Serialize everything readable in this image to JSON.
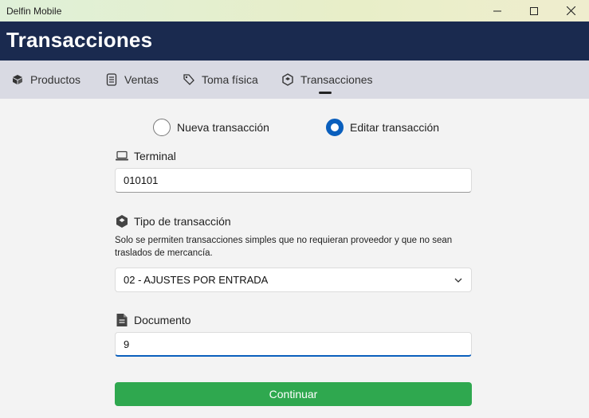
{
  "window": {
    "title": "Delfin Mobile",
    "controls": {
      "minimize": "minimize-icon",
      "maximize": "maximize-icon",
      "close": "close-icon"
    }
  },
  "header": {
    "title": "Transacciones"
  },
  "tabs": [
    {
      "label": "Productos",
      "icon": "box-icon"
    },
    {
      "label": "Ventas",
      "icon": "receipt-icon"
    },
    {
      "label": "Toma física",
      "icon": "tag-icon"
    },
    {
      "label": "Transacciones",
      "icon": "transaction-icon",
      "selected": true
    }
  ],
  "mode": {
    "options": [
      {
        "label": "Nueva transacción",
        "checked": false
      },
      {
        "label": "Editar transacción",
        "checked": true
      }
    ]
  },
  "terminal": {
    "label": "Terminal",
    "value": "010101",
    "icon": "laptop-icon"
  },
  "transaction_type": {
    "label": "Tipo de transacción",
    "icon": "transaction-icon",
    "helper": "Solo se permiten transacciones simples que no requieran proveedor y que no sean traslados de mercancía.",
    "selected": "02 - AJUSTES POR ENTRADA"
  },
  "document": {
    "label": "Documento",
    "value": "9",
    "icon": "document-icon"
  },
  "actions": {
    "continue_label": "Continuar"
  },
  "colors": {
    "header_bg": "#1a2a4f",
    "accent": "#0a5fbd",
    "button": "#2fa84f",
    "tabbar_bg": "#d9dae3"
  }
}
